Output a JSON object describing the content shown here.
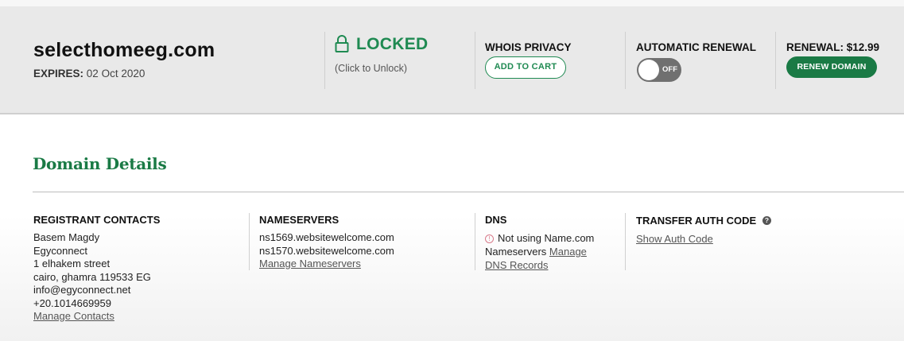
{
  "header": {
    "domain": "selecthomeeg.com",
    "expires_label": "EXPIRES:",
    "expires_date": "02 Oct 2020",
    "lock": {
      "status": "LOCKED",
      "hint": "(Click to Unlock)",
      "icon": "padlock-icon"
    },
    "whois": {
      "title": "WHOIS PRIVACY",
      "button": "ADD TO CART"
    },
    "renewal": {
      "title": "AUTOMATIC RENEWAL",
      "toggle_state": "OFF"
    },
    "renew": {
      "title": "RENEWAL: $12.99",
      "button": "RENEW DOMAIN"
    }
  },
  "details": {
    "title": "Domain Details",
    "registrant": {
      "title": "REGISTRANT CONTACTS",
      "lines": [
        "Basem Magdy",
        "Egyconnect",
        "1 elhakem street",
        "cairo, ghamra 119533 EG",
        "info@egyconnect.net",
        "+20.1014669959"
      ],
      "link": "Manage Contacts"
    },
    "nameservers": {
      "title": "NAMESERVERS",
      "lines": [
        "ns1569.websitewelcome.com",
        "ns1570.websitewelcome.com"
      ],
      "link": "Manage Nameservers"
    },
    "dns": {
      "title": "DNS",
      "line1": "Not using Name.com",
      "line2_text": "Nameservers",
      "link_part1": "Manage",
      "link_part2": "DNS Records",
      "icon": "info-circle-icon"
    },
    "transfer": {
      "title": "TRANSFER AUTH CODE",
      "help_icon": "help-icon",
      "help_glyph": "?",
      "link": "Show Auth Code"
    }
  },
  "colors": {
    "accent_green": "#1a7a45",
    "header_bg": "#e9e9e9"
  }
}
